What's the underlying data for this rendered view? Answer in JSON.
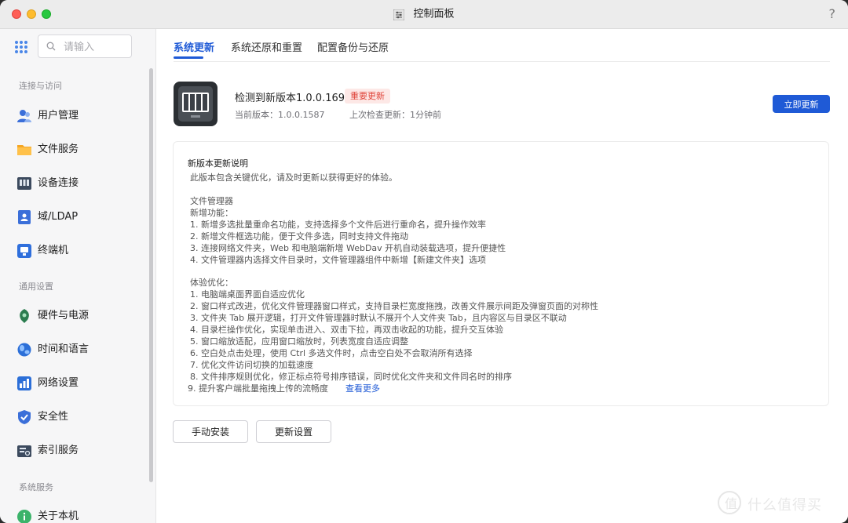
{
  "window": {
    "title": "控制面板",
    "help": "?"
  },
  "sidebar": {
    "search_placeholder": "请输入",
    "sections": [
      {
        "label": "连接与访问"
      },
      {
        "label": "通用设置"
      },
      {
        "label": "系统服务"
      }
    ],
    "items": [
      {
        "label": "用户管理",
        "icon": "user-icon",
        "color": "#3b6fd9"
      },
      {
        "label": "文件服务",
        "icon": "folder-icon",
        "color": "#f5a623"
      },
      {
        "label": "设备连接",
        "icon": "device-icon",
        "color": "#3c4a5e"
      },
      {
        "label": "域/LDAP",
        "icon": "domain-icon",
        "color": "#3b6fd9"
      },
      {
        "label": "终端机",
        "icon": "terminal-icon",
        "color": "#2f6fdc"
      },
      {
        "label": "硬件与电源",
        "icon": "hardware-icon",
        "color": "#2b7d4f"
      },
      {
        "label": "时间和语言",
        "icon": "globe-icon",
        "color": "#2c6fd8"
      },
      {
        "label": "网络设置",
        "icon": "network-icon",
        "color": "#2c6fd8"
      },
      {
        "label": "安全性",
        "icon": "shield-icon",
        "color": "#3b6fd9"
      },
      {
        "label": "索引服务",
        "icon": "index-icon",
        "color": "#3c4a5e"
      },
      {
        "label": "关于本机",
        "icon": "info-icon",
        "color": "#3bb36a"
      }
    ]
  },
  "tabs": [
    {
      "label": "系统更新"
    },
    {
      "label": "系统还原和重置"
    },
    {
      "label": "配置备份与还原"
    }
  ],
  "update": {
    "title": "检测到新版本1.0.0.1696",
    "badge": "重要更新",
    "current_version": "当前版本：1.0.0.1587",
    "last_check": "上次检查更新：1分钟前",
    "update_now": "立即更新"
  },
  "notes": {
    "title": "新版本更新说明",
    "subtitle": "此版本包含关键优化，请及时更新以获得更好的体验。",
    "file_manager_title": "文件管理器",
    "new_features_title": "新增功能：",
    "new_features": [
      "1. 新增多选批量重命名功能，支持选择多个文件后进行重命名，提升操作效率",
      "2. 新增文件框选功能，便于文件多选，同时支持文件拖动",
      "3. 连接网络文件夹，Web 和电脑端新增 WebDav 开机自动装载选项，提升便捷性",
      "4. 文件管理器内选择文件目录时，文件管理器组件中新增【新建文件夹】选项"
    ],
    "experience_title": "体验优化：",
    "experience": [
      "1. 电脑端桌面界面自适应优化",
      "2. 窗口样式改进，优化文件管理器窗口样式，支持目录栏宽度拖拽，改善文件展示间距及弹窗页面的对称性",
      "3. 文件夹 Tab 展开逻辑，打开文件管理器时默认不展开个人文件夹 Tab，且内容区与目录区不联动",
      "4. 目录栏操作优化，实现单击进入、双击下拉，再双击收起的功能，提升交互体验",
      "5. 窗口缩放适配，应用窗口缩放时，列表宽度自适应调整",
      "6. 空白处点击处理，使用 Ctrl 多选文件时，点击空白处不会取消所有选择",
      "7. 优化文件访问切换的加载速度",
      "8. 文件排序规则优化，修正标点符号排序错误，同时优化文件夹和文件同名时的排序",
      "9. 提升客户端批量拖拽上传的流畅度"
    ],
    "view_more": "查看更多"
  },
  "actions": {
    "manual_install": "手动安装",
    "update_settings": "更新设置"
  },
  "watermark": {
    "glyph": "值",
    "text": "什么值得买"
  },
  "colors": {
    "accent": "#1f5ad6",
    "badge_text": "#e0463c",
    "badge_bg": "#fde8e6"
  }
}
